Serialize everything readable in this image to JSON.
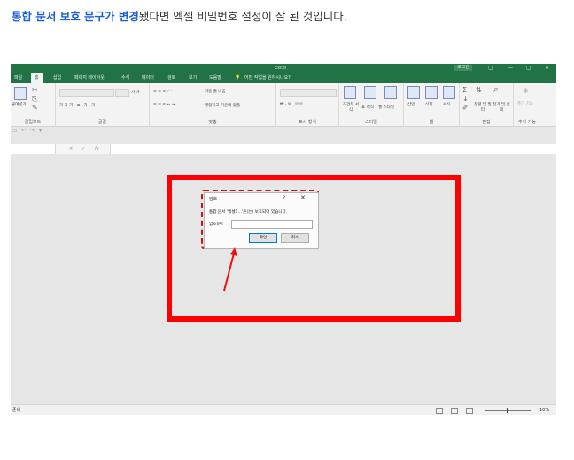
{
  "caption": {
    "highlight": "통합 문서 보호 문구가 변경",
    "rest": "됐다면 엑셀 비밀번호 설정이 잘 된 것입니다."
  },
  "excel": {
    "title": "Excel",
    "login_label": "로그인",
    "window_buttons": [
      "▢",
      "—",
      "▢",
      "✕"
    ],
    "tabs": [
      "파일",
      "홈",
      "삽입",
      "페이지 레이아웃",
      "수식",
      "데이터",
      "검토",
      "보기",
      "도움말"
    ],
    "tell_me": "어떤 작업을 원하시나요?",
    "ribbon": {
      "clipboard": {
        "paste": "붙여넣기",
        "label": "클립보드"
      },
      "font": {
        "label": "글꼴"
      },
      "alignment": {
        "wrap": "자동 줄 바꿈",
        "merge": "병합하고 가운데 맞춤",
        "label": "맞춤"
      },
      "number": {
        "label": "표시 형식"
      },
      "styles": {
        "conditional": "조건부 서식",
        "format_table": "표 서식",
        "cell_styles": "셀 스타일",
        "label": "스타일"
      },
      "cells": {
        "insert": "삽입",
        "delete": "삭제",
        "format": "서식",
        "label": "셀"
      },
      "editing": {
        "sort": "정렬 및 필터",
        "find": "찾기 및 선택",
        "label": "편집"
      },
      "addins": {
        "label": "추가 기능",
        "name": "추가 기능"
      }
    },
    "formula_bar": {
      "x": "✕",
      "check": "✓",
      "fx": "fx"
    },
    "status": {
      "ready": "준비",
      "zoom": "10%"
    }
  },
  "dialog": {
    "title": "암호",
    "help": "?",
    "close": "✕",
    "message": "통합 문서 '엑셀1...'은(는) 보호되어 있습니다.",
    "password_label": "암호(P):",
    "ok_label": "확인",
    "cancel_label": "취소"
  },
  "colors": {
    "excel_green": "#217346",
    "highlight_red": "#ff0000",
    "caption_blue": "#1a5fd6"
  }
}
